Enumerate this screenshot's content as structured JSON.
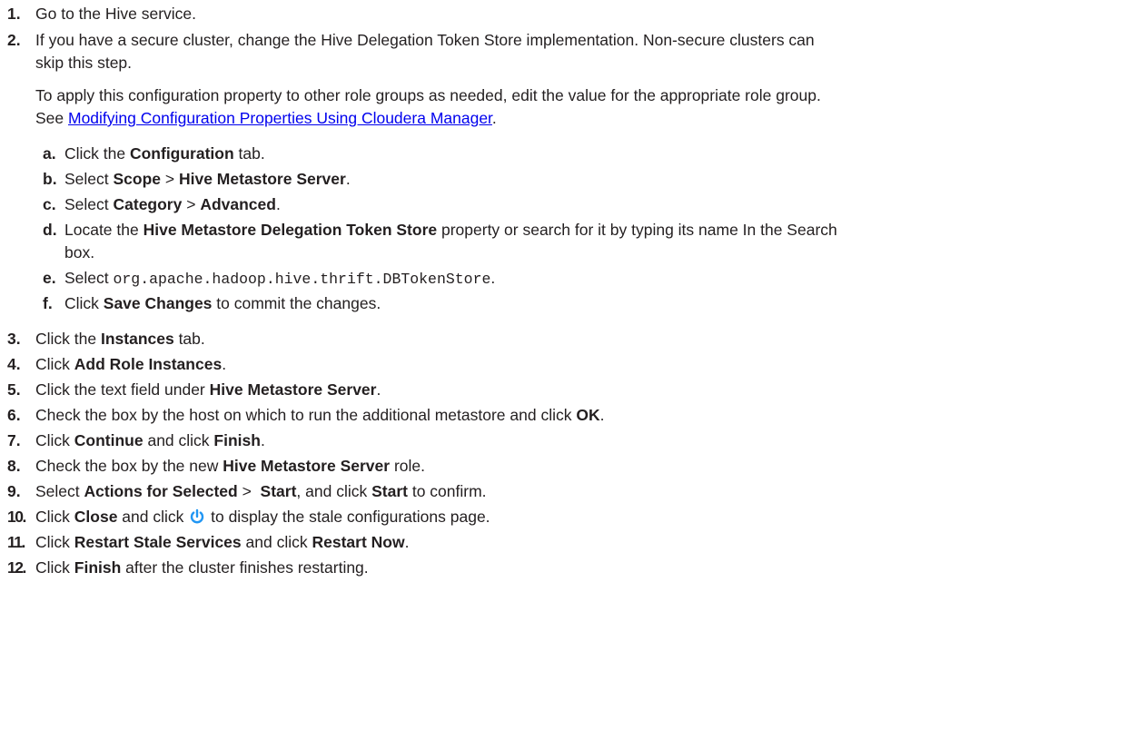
{
  "steps": [
    {
      "num": "1.",
      "text": "Go to the Hive service."
    },
    {
      "num": "2.",
      "line1": "If you have a secure cluster, change the Hive Delegation Token Store implementation. Non-secure clusters can",
      "line2": "skip this step.",
      "para_line1": "To apply this configuration property to other role groups as needed, edit the value for the appropriate role group.",
      "para_see": "See ",
      "para_link": "Modifying Configuration Properties Using Cloudera Manager",
      "para_end": ".",
      "substeps": [
        {
          "num": "a.",
          "pre": "Click the ",
          "b1": "Configuration",
          "post": " tab."
        },
        {
          "num": "b.",
          "pre": "Select ",
          "b1": "Scope",
          "mid": " > ",
          "b2": "Hive Metastore Server",
          "post": "."
        },
        {
          "num": "c.",
          "pre": "Select ",
          "b1": "Category",
          "mid": " > ",
          "b2": "Advanced",
          "post": "."
        },
        {
          "num": "d.",
          "pre": "Locate the ",
          "b1": "Hive Metastore Delegation Token Store",
          "post": " property or search for it by typing its name In the Search",
          "line2": "box."
        },
        {
          "num": "e.",
          "pre": "Select ",
          "code": "org.apache.hadoop.hive.thrift.DBTokenStore",
          "post": "."
        },
        {
          "num": "f.",
          "pre": "Click ",
          "b1": "Save Changes",
          "post": " to commit the changes."
        }
      ]
    },
    {
      "num": "3.",
      "pre": "Click the ",
      "b1": "Instances",
      "post": " tab."
    },
    {
      "num": "4.",
      "pre": "Click ",
      "b1": "Add Role Instances",
      "post": "."
    },
    {
      "num": "5.",
      "pre": "Click the text field under ",
      "b1": "Hive Metastore Server",
      "post": "."
    },
    {
      "num": "6.",
      "pre": "Check the box by the host on which to run the additional metastore and click ",
      "b1": "OK",
      "post": "."
    },
    {
      "num": "7.",
      "pre": "Click ",
      "b1": "Continue",
      "mid": " and click ",
      "b2": "Finish",
      "post": "."
    },
    {
      "num": "8.",
      "pre": "Check the box by the new ",
      "b1": "Hive Metastore Server",
      "post": " role."
    },
    {
      "num": "9.",
      "pre": "Select ",
      "b1": "Actions for Selected",
      "mid": " >  ",
      "b2": "Start",
      "mid2": ", and click ",
      "b3": "Start",
      "post": " to confirm."
    },
    {
      "num": "10.",
      "pre": "Click ",
      "b1": "Close",
      "mid": " and click ",
      "icon": "power-icon",
      "post": " to display the stale configurations page."
    },
    {
      "num": "11.",
      "pre": "Click ",
      "b1": "Restart Stale Services",
      "mid": " and click ",
      "b2": "Restart Now",
      "post": "."
    },
    {
      "num": "12.",
      "pre": "Click ",
      "b1": "Finish",
      "post": " after the cluster finishes restarting."
    }
  ],
  "colors": {
    "text": "#231f20",
    "link": "#0000ee",
    "icon": "#2196f3"
  }
}
